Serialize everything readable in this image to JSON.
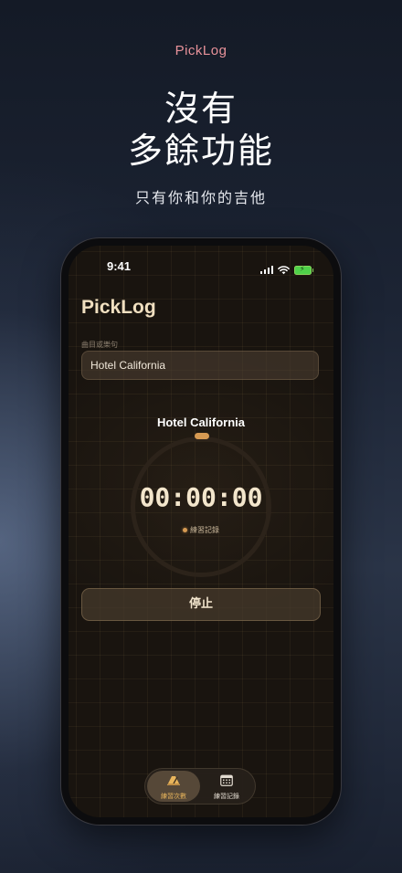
{
  "promo": {
    "brand": "PickLog",
    "headline_line1": "沒有",
    "headline_line2": "多餘功能",
    "tagline": "只有你和你的吉他"
  },
  "status_bar": {
    "time": "9:41"
  },
  "app": {
    "title": "PickLog",
    "song_field": {
      "label": "曲目或樂句",
      "value": "Hotel California"
    },
    "current_song": "Hotel California",
    "timer": {
      "display": "00:00:00",
      "status": "練習記錄"
    },
    "stop_button": "停止",
    "tabs": [
      {
        "label": "練習次數",
        "icon": "metronome-icon",
        "active": true
      },
      {
        "label": "練習記錄",
        "icon": "calendar-icon",
        "active": false
      }
    ]
  },
  "colors": {
    "brand_accent": "#e8929a",
    "timer_accent": "#d69a52",
    "active_tab": "#e9b55c"
  }
}
